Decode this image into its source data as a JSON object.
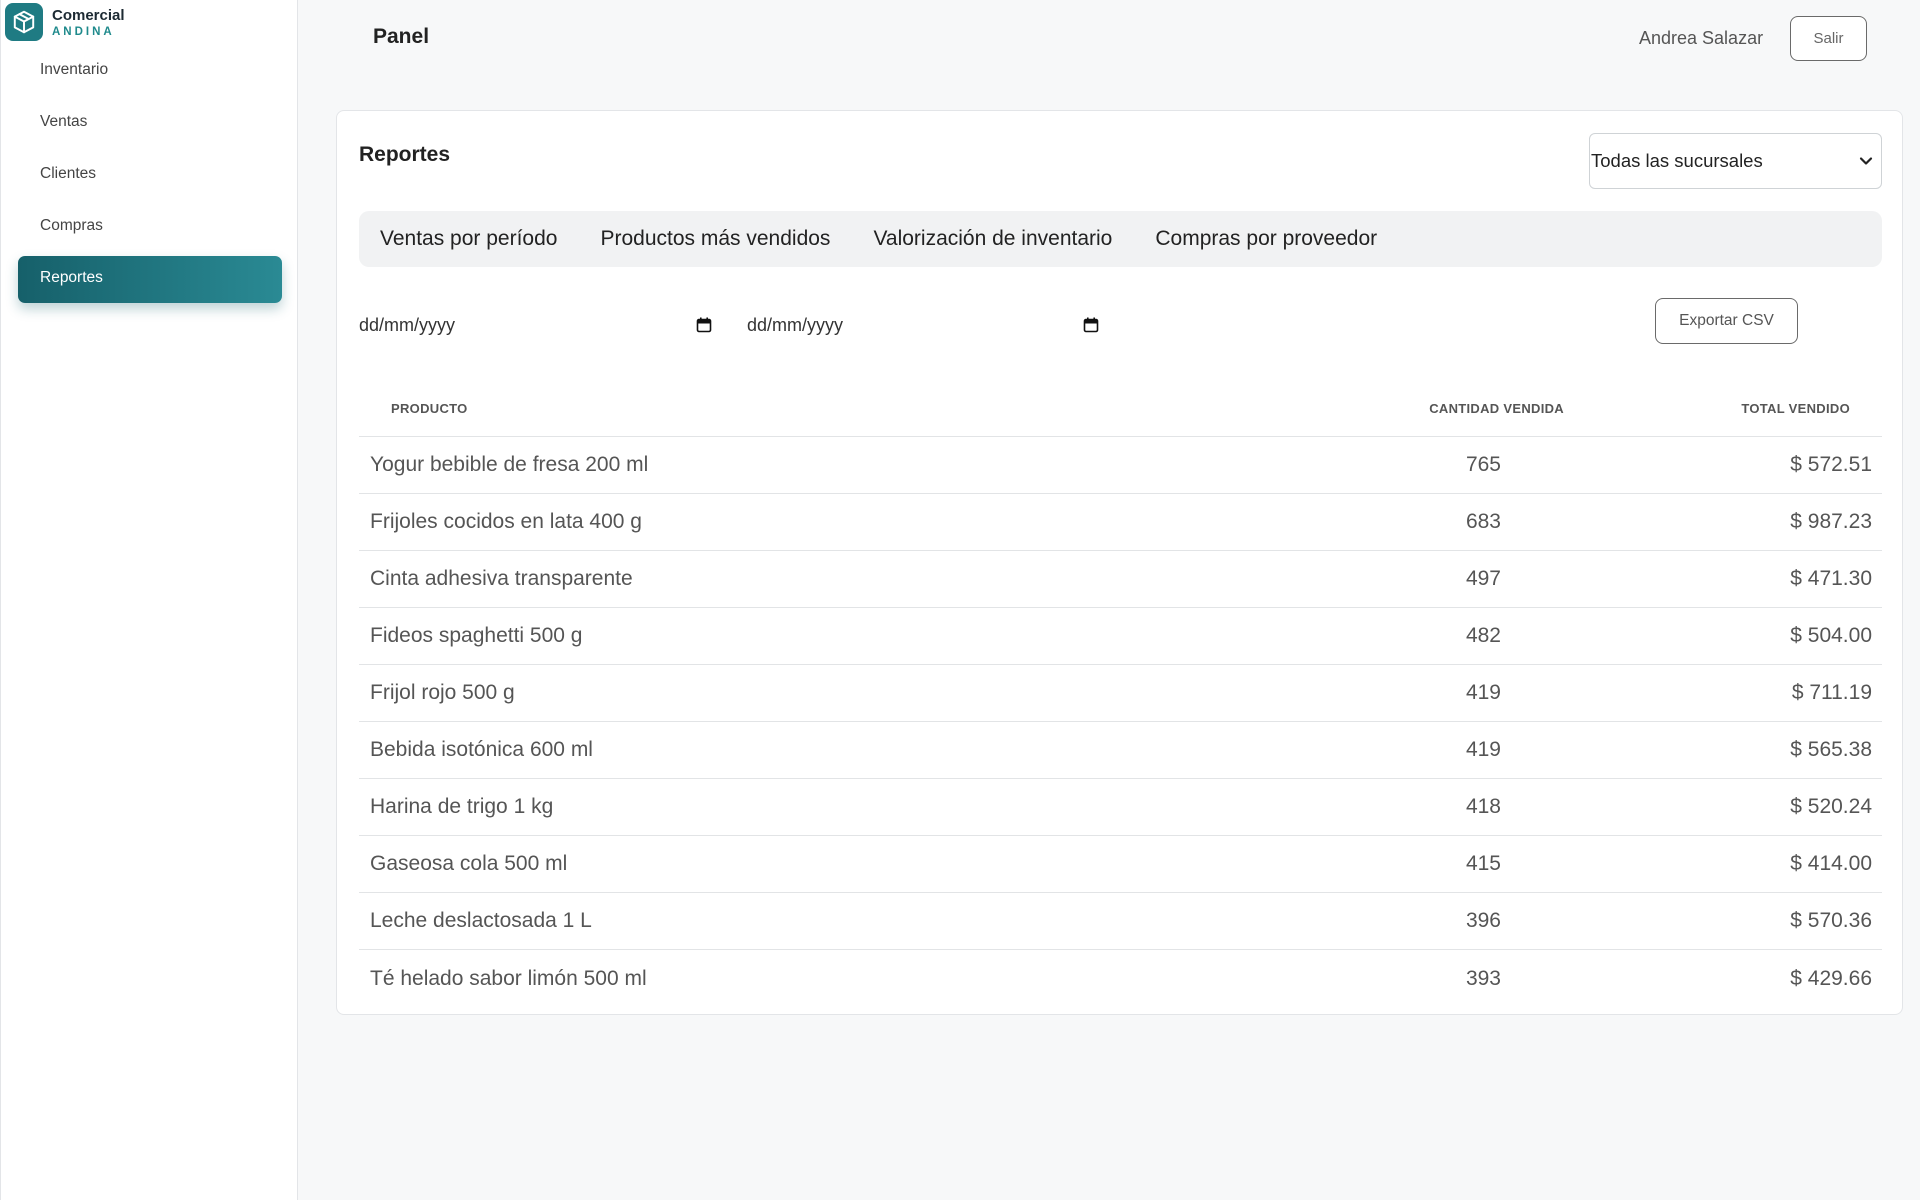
{
  "brand": {
    "name": "Comercial",
    "subtitle": "ANDINA",
    "logo_icon": "box-icon",
    "accent_color": "#1f7b83"
  },
  "sidebar": {
    "items": [
      {
        "label": "Inventario",
        "active": false
      },
      {
        "label": "Ventas",
        "active": false
      },
      {
        "label": "Clientes",
        "active": false
      },
      {
        "label": "Compras",
        "active": false
      },
      {
        "label": "Reportes",
        "active": true
      }
    ]
  },
  "header": {
    "title": "Panel",
    "user_name": "Andrea Salazar",
    "logout_label": "Salir"
  },
  "reports": {
    "title": "Reportes",
    "branch_select": {
      "value": "Todas las sucursales",
      "icon": "chevron-down-icon"
    },
    "tabs": [
      {
        "label": "Ventas por período"
      },
      {
        "label": "Productos más vendidos"
      },
      {
        "label": "Valorización de inventario"
      },
      {
        "label": "Compras por proveedor"
      }
    ],
    "date_from": {
      "placeholder": "dd/mm/yyyy",
      "icon": "calendar-icon"
    },
    "date_to": {
      "placeholder": "dd/mm/yyyy",
      "icon": "calendar-icon"
    },
    "export_label": "Exportar CSV",
    "table": {
      "columns": [
        "PRODUCTO",
        "CANTIDAD VENDIDA",
        "TOTAL VENDIDO"
      ],
      "rows": [
        {
          "product": "Yogur bebible de fresa 200 ml",
          "qty": "765",
          "total": "$ 572.51"
        },
        {
          "product": "Frijoles cocidos en lata 400 g",
          "qty": "683",
          "total": "$ 987.23"
        },
        {
          "product": "Cinta adhesiva transparente",
          "qty": "497",
          "total": "$ 471.30"
        },
        {
          "product": "Fideos spaghetti 500 g",
          "qty": "482",
          "total": "$ 504.00"
        },
        {
          "product": "Frijol rojo 500 g",
          "qty": "419",
          "total": "$ 711.19"
        },
        {
          "product": "Bebida isotónica 600 ml",
          "qty": "419",
          "total": "$ 565.38"
        },
        {
          "product": "Harina de trigo 1 kg",
          "qty": "418",
          "total": "$ 520.24"
        },
        {
          "product": "Gaseosa cola 500 ml",
          "qty": "415",
          "total": "$ 414.00"
        },
        {
          "product": "Leche deslactosada 1 L",
          "qty": "396",
          "total": "$ 570.36"
        },
        {
          "product": "Té helado sabor limón 500 ml",
          "qty": "393",
          "total": "$ 429.66"
        }
      ]
    }
  }
}
